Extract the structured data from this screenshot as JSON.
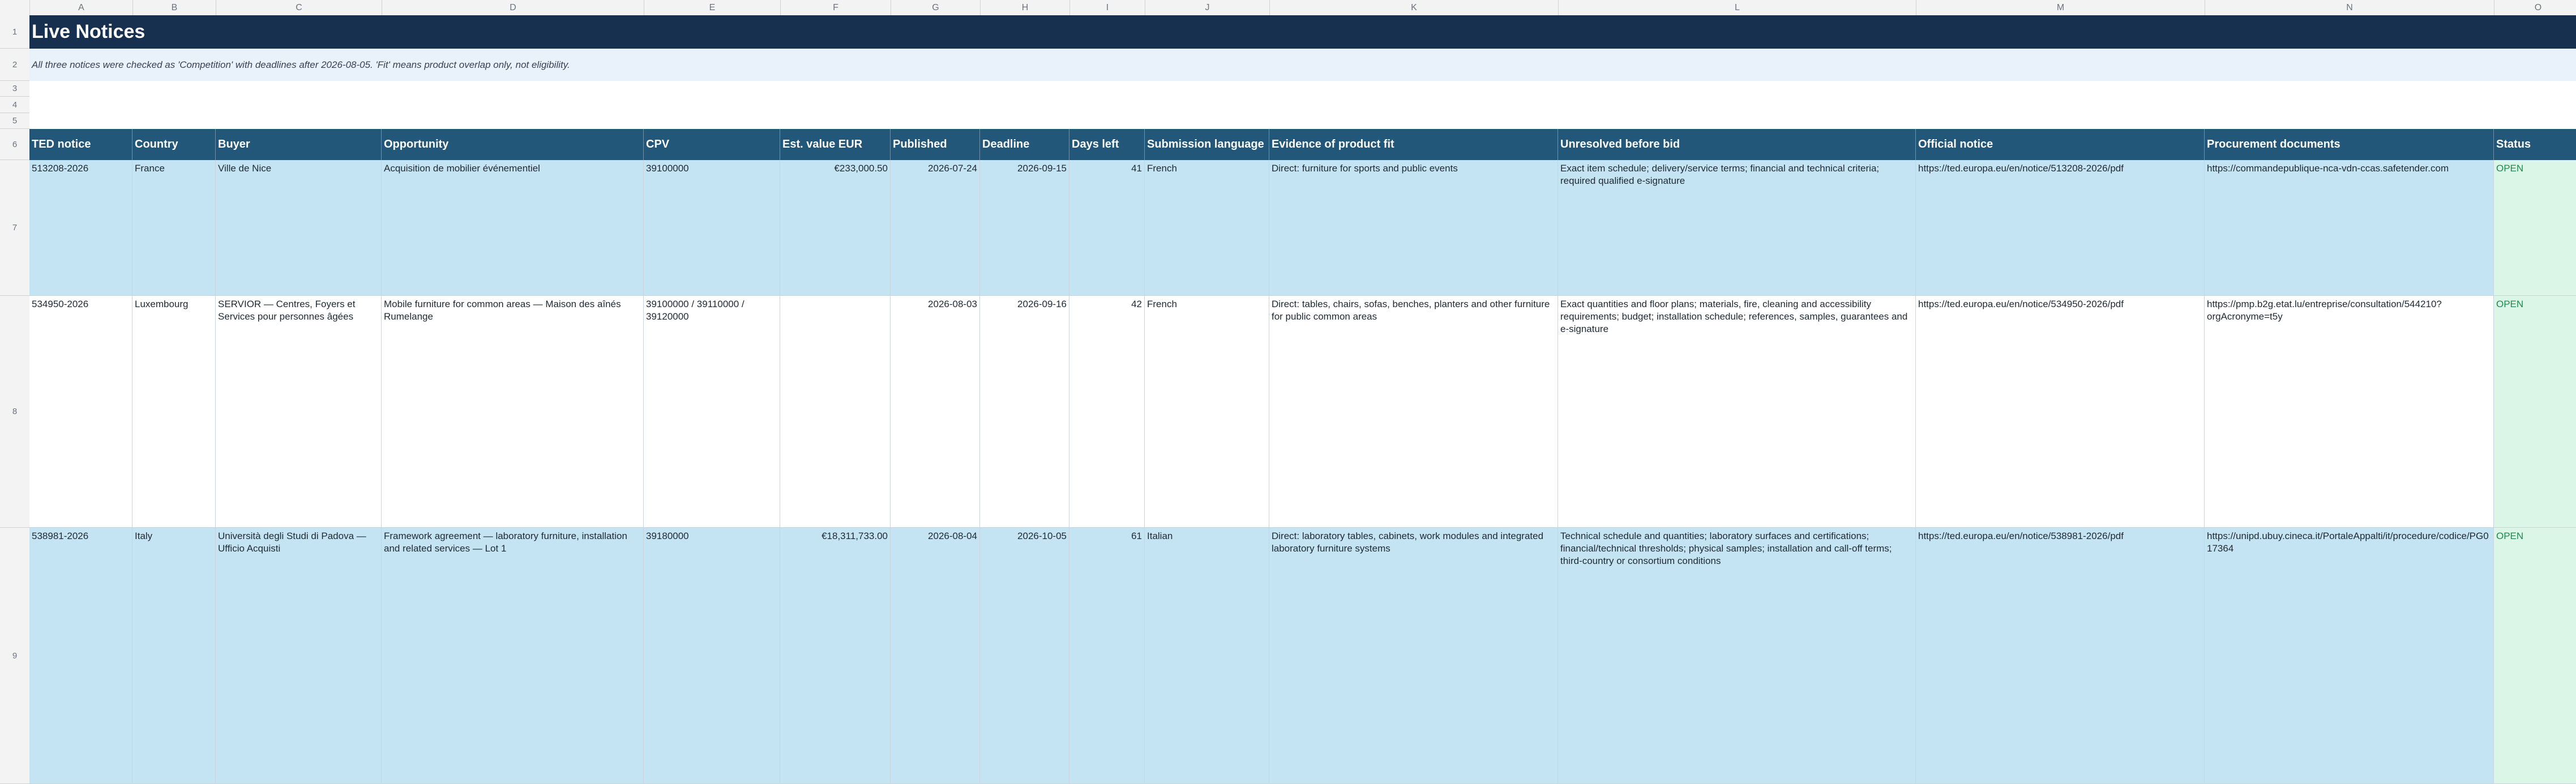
{
  "sheet": {
    "column_letters": [
      "A",
      "B",
      "C",
      "D",
      "E",
      "F",
      "G",
      "H",
      "I",
      "J",
      "K",
      "L",
      "M",
      "N",
      "O"
    ],
    "row_numbers": [
      "1",
      "2",
      "3",
      "4",
      "5",
      "6",
      "7",
      "8",
      "9"
    ],
    "title": "Live Notices",
    "note": "All three notices were checked as 'Competition' with deadlines after 2026-08-05. 'Fit' means product overlap only, not eligibility.",
    "headers": [
      "TED notice",
      "Country",
      "Buyer",
      "Opportunity",
      "CPV",
      "Est. value EUR",
      "Published",
      "Deadline",
      "Days left",
      "Submission language",
      "Evidence of product fit",
      "Unresolved before bid",
      "Official notice",
      "Procurement documents",
      "Status"
    ],
    "rows": [
      {
        "ted": "513208-2026",
        "country": "France",
        "buyer": "Ville de Nice",
        "opportunity": "Acquisition de mobilier événementiel",
        "cpv": "39100000",
        "value": "€233,000.50",
        "published": "2026-07-24",
        "deadline": "2026-09-15",
        "days_left": "41",
        "language": "French",
        "evidence": "Direct: furniture for sports and public events",
        "unresolved": "Exact item schedule; delivery/service terms; financial and technical criteria; required qualified e-signature",
        "official": "https://ted.europa.eu/en/notice/513208-2026/pdf",
        "documents": "https://commandepublique-nca-vdn-ccas.safetender.com",
        "status": "OPEN"
      },
      {
        "ted": "534950-2026",
        "country": "Luxembourg",
        "buyer": "SERVIOR — Centres, Foyers et Services pour personnes âgées",
        "opportunity": "Mobile furniture for common areas — Maison des aînés Rumelange",
        "cpv": "39100000 / 39110000 / 39120000",
        "value": "",
        "published": "2026-08-03",
        "deadline": "2026-09-16",
        "days_left": "42",
        "language": "French",
        "evidence": "Direct: tables, chairs, sofas, benches, planters and other furniture for public common areas",
        "unresolved": "Exact quantities and floor plans; materials, fire, cleaning and accessibility requirements; budget; installation schedule; references, samples, guarantees and e-signature",
        "official": "https://ted.europa.eu/en/notice/534950-2026/pdf",
        "documents": "https://pmp.b2g.etat.lu/entreprise/consultation/544210?orgAcronyme=t5y",
        "status": "OPEN"
      },
      {
        "ted": "538981-2026",
        "country": "Italy",
        "buyer": "Università degli Studi di Padova — Ufficio Acquisti",
        "opportunity": "Framework agreement — laboratory furniture, installation and related services — Lot 1",
        "cpv": "39180000",
        "value": "€18,311,733.00",
        "published": "2026-08-04",
        "deadline": "2026-10-05",
        "days_left": "61",
        "language": "Italian",
        "evidence": "Direct: laboratory tables, cabinets, work modules and integrated laboratory furniture systems",
        "unresolved": "Technical schedule and quantities; laboratory surfaces and certifications; financial/technical thresholds; physical samples; installation and call-off terms; third-country or consortium conditions",
        "official": "https://ted.europa.eu/en/notice/538981-2026/pdf",
        "documents": "https://unipd.ubuy.cineca.it/PortaleAppalti/it/procedure/codice/PG017364",
        "status": "OPEN"
      }
    ]
  },
  "colors": {
    "title_bg": "#17304f",
    "header_bg": "#22577a",
    "row_blue": "#c4e4f3",
    "status_bg": "#dbf5e7",
    "status_text": "#1d8a4e"
  }
}
